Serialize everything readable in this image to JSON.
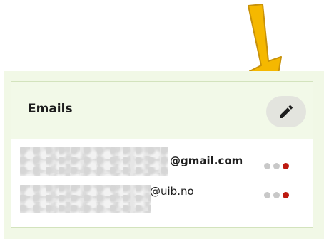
{
  "emails_card": {
    "title": "Emails",
    "edit_icon": "pencil-icon",
    "items": [
      {
        "domain": "@gmail.com",
        "status_dots": [
          "gray",
          "gray",
          "red"
        ]
      },
      {
        "domain": "@uib.no",
        "status_dots": [
          "gray",
          "gray",
          "red"
        ]
      }
    ]
  },
  "annotation": {
    "icon": "arrow-down-icon",
    "color": "#f5b800"
  },
  "colors": {
    "panel_bg": "#f1f8e6",
    "header_bg": "#f2f9e8",
    "border": "#d3e3bd",
    "status_red": "#bd1a10",
    "status_gray": "#c8c8c8"
  }
}
